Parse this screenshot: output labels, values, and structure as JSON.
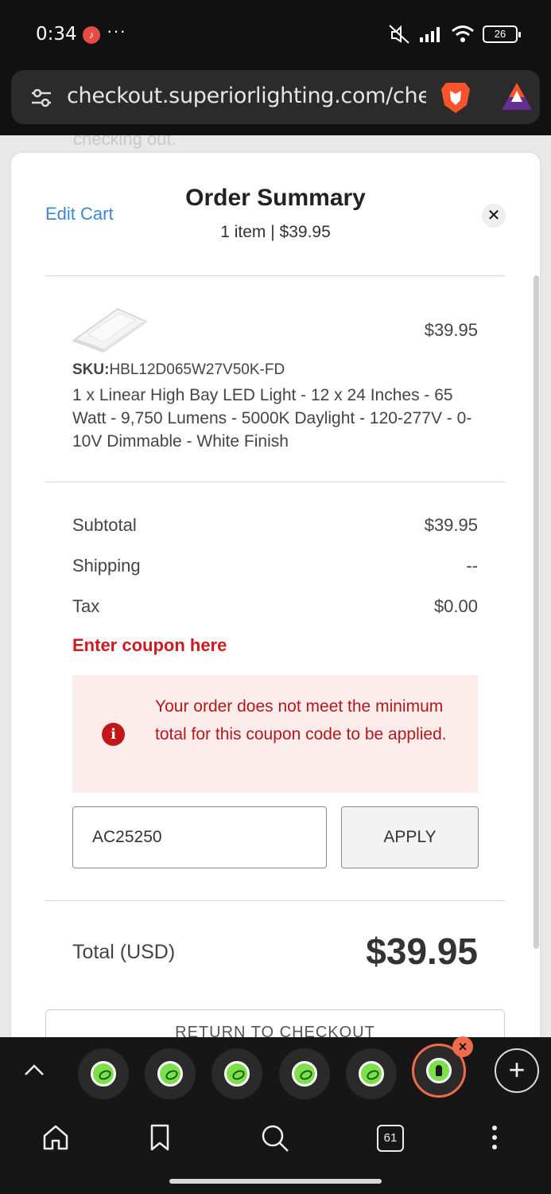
{
  "status_bar": {
    "time": "0:34",
    "battery": "26",
    "more": "···"
  },
  "browser": {
    "url": "checkout.superiorlighting.com/chec",
    "tab_count": "61"
  },
  "page": {
    "behind_text": "checking out.",
    "edit_cart": "Edit Cart",
    "title": "Order Summary",
    "subtitle": "1 item | $39.95",
    "close": "✕",
    "item": {
      "price": "$39.95",
      "sku_label": "SKU:",
      "sku": "HBL12D065W27V50K-FD",
      "description": "1 x Linear High Bay LED Light - 12 x 24 Inches - 65 Watt - 9,750 Lumens - 5000K Daylight - 120-277V - 0-10V Dimmable - White Finish"
    },
    "summary": {
      "subtotal_label": "Subtotal",
      "subtotal_value": "$39.95",
      "shipping_label": "Shipping",
      "shipping_value": "--",
      "tax_label": "Tax",
      "tax_value": "$0.00"
    },
    "coupon": {
      "link": "Enter coupon here",
      "error": "Your order does not meet the minimum total for this coupon code to be applied.",
      "input_value": "AC25250",
      "apply": "APPLY"
    },
    "total_label": "Total (USD)",
    "total_value": "$39.95",
    "return_button": "RETURN TO CHECKOUT"
  },
  "colors": {
    "link": "#3b89d6",
    "error": "#d0191c",
    "alert_bg": "#fdecec",
    "tab_active": "#f06b4b"
  }
}
